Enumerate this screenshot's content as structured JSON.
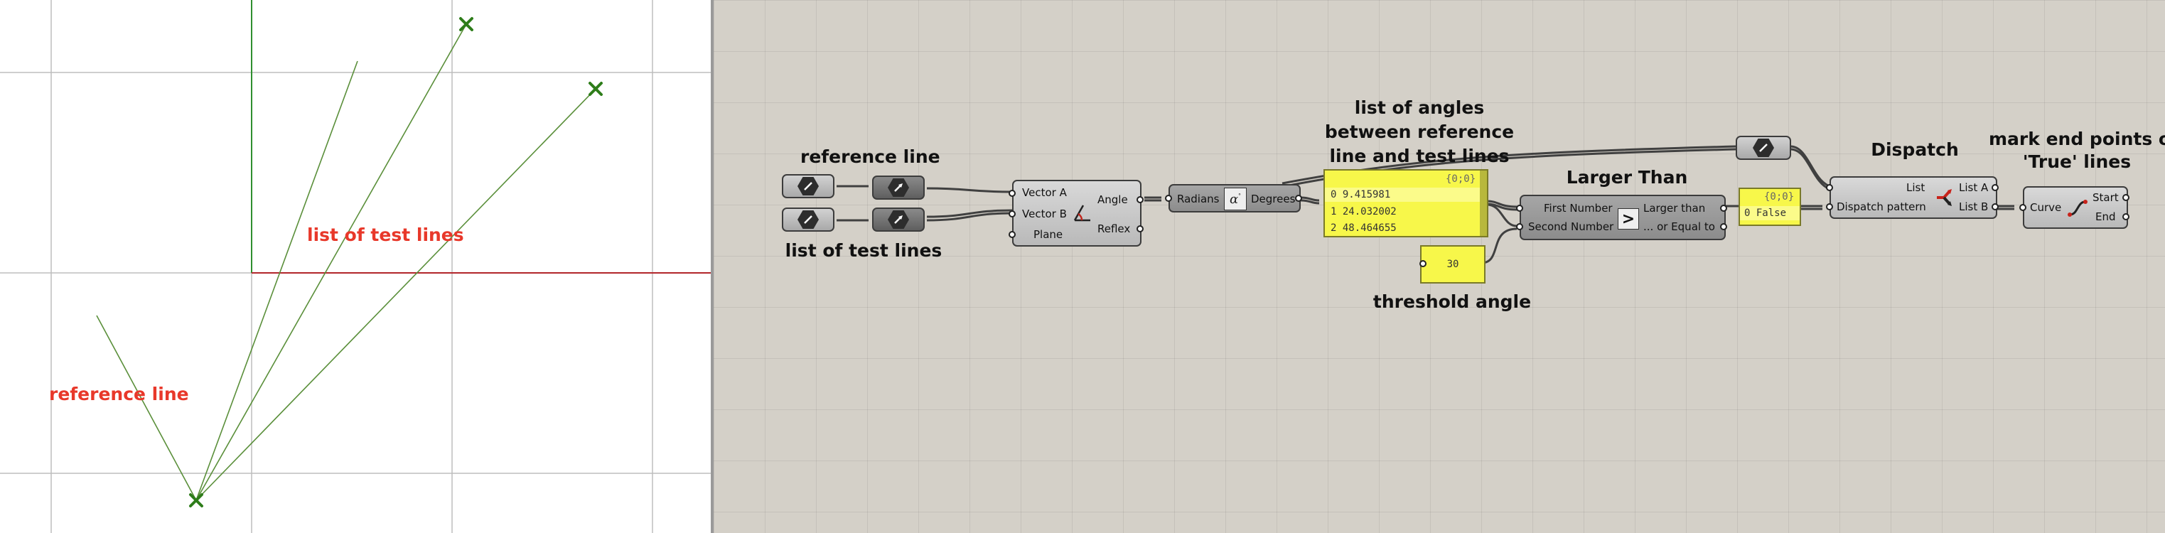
{
  "viewport": {
    "labels": {
      "test_lines": "list of test lines",
      "reference_line": "reference line"
    },
    "colors": {
      "grid": "#bdbdbd",
      "axis_x": "#b2262b",
      "axis_y": "#2f8f2f",
      "geometry": "#5a8f3a",
      "point": "#2e7d1a",
      "label": "#e8382a"
    }
  },
  "canvas": {
    "background": "#d4d0c8",
    "wire_color": "#404040"
  },
  "components": {
    "angle": {
      "inputs": [
        "Vector A",
        "Vector B",
        "Plane"
      ],
      "outputs": [
        "Angle",
        "Reflex"
      ],
      "icon": "angle-icon"
    },
    "degrees": {
      "input": "Radians",
      "output": "Degrees",
      "icon": "alpha-degrees-icon"
    },
    "larger": {
      "title": "Larger Than",
      "inputs": [
        "First Number",
        "Second Number"
      ],
      "outputs": [
        "Larger than",
        "... or Equal to"
      ],
      "icon": "greater-than-icon",
      "symbol": ">"
    },
    "dispatch": {
      "title": "Dispatch",
      "inputs": [
        "List",
        "Dispatch pattern"
      ],
      "outputs": [
        "List A",
        "List B"
      ],
      "icon": "dispatch-icon"
    },
    "endpoints": {
      "title": "mark end points of\n'True' lines",
      "input": "Curve",
      "outputs": [
        "Start",
        "End"
      ],
      "icon": "curve-icon"
    }
  },
  "labels": {
    "reference_line": "reference line",
    "test_lines": "list of test lines",
    "angles_panel_title": "list of angles\nbetween reference\nline and test lines",
    "threshold": "threshold angle"
  },
  "panels": {
    "angles": {
      "header": "{0;0}",
      "rows": [
        "0 9.415981",
        "1 24.032002",
        "2 48.464655"
      ]
    },
    "threshold": {
      "value": "30"
    },
    "result": {
      "header": "{0;0}",
      "row": "0 False"
    }
  }
}
